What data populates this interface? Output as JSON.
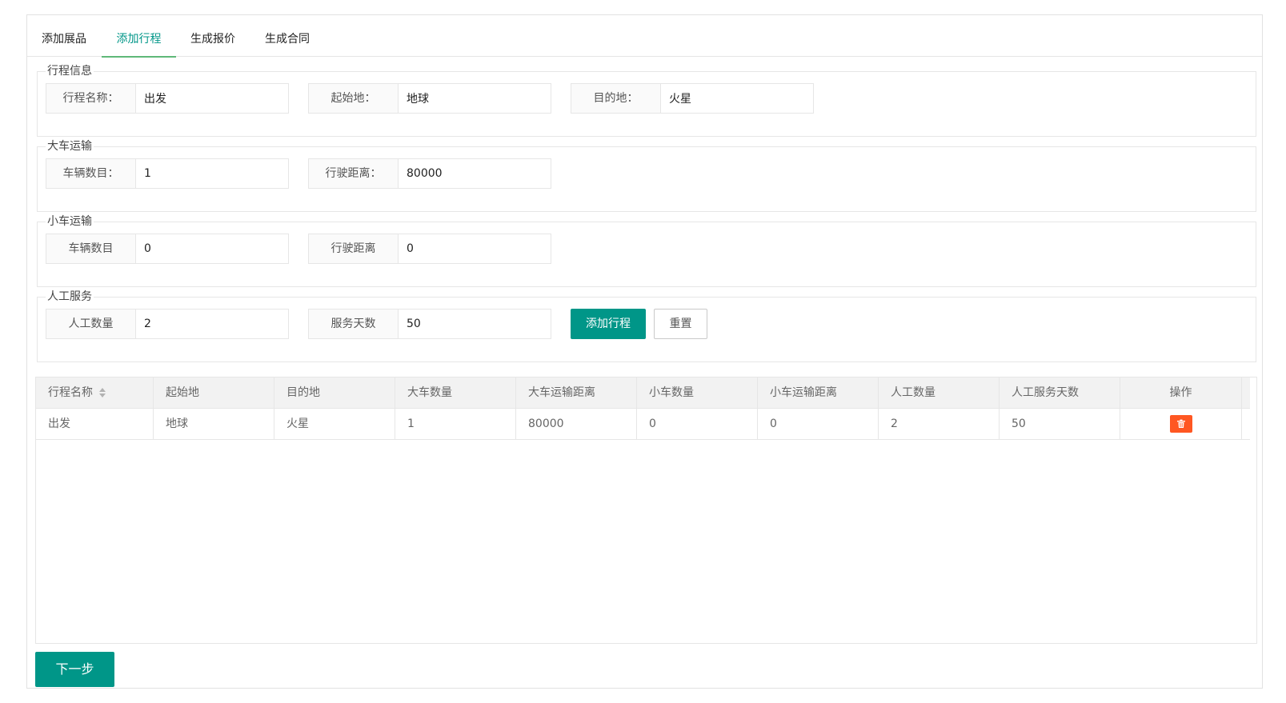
{
  "tabs": [
    {
      "label": "添加展品",
      "active": false
    },
    {
      "label": "添加行程",
      "active": true
    },
    {
      "label": "生成报价",
      "active": false
    },
    {
      "label": "生成合同",
      "active": false
    }
  ],
  "sections": {
    "trip_info": {
      "legend": "行程信息",
      "name_label": "行程名称：",
      "name_value": "出发",
      "origin_label": "起始地：",
      "origin_value": "地球",
      "dest_label": "目的地：",
      "dest_value": "火星"
    },
    "big_truck": {
      "legend": "大车运输",
      "count_label": "车辆数目：",
      "count_value": "1",
      "distance_label": "行驶距离：",
      "distance_value": "80000"
    },
    "small_truck": {
      "legend": "小车运输",
      "count_label": "车辆数目",
      "count_value": "0",
      "distance_label": "行驶距离",
      "distance_value": "0"
    },
    "labor": {
      "legend": "人工服务",
      "count_label": "人工数量",
      "count_value": "2",
      "days_label": "服务天数",
      "days_value": "50",
      "add_button": "添加行程",
      "reset_button": "重置"
    }
  },
  "table": {
    "columns": [
      "行程名称",
      "起始地",
      "目的地",
      "大车数量",
      "大车运输距离",
      "小车数量",
      "小车运输距离",
      "人工数量",
      "人工服务天数",
      "操作"
    ],
    "rows": [
      [
        "出发",
        "地球",
        "火星",
        "1",
        "80000",
        "0",
        "0",
        "2",
        "50"
      ]
    ],
    "delete_icon": "trash-icon",
    "delete_color": "#FF5722"
  },
  "next_button": "下一步",
  "colors": {
    "primary": "#009688",
    "tab_underline": "#5FB878",
    "danger": "#FF5722"
  }
}
